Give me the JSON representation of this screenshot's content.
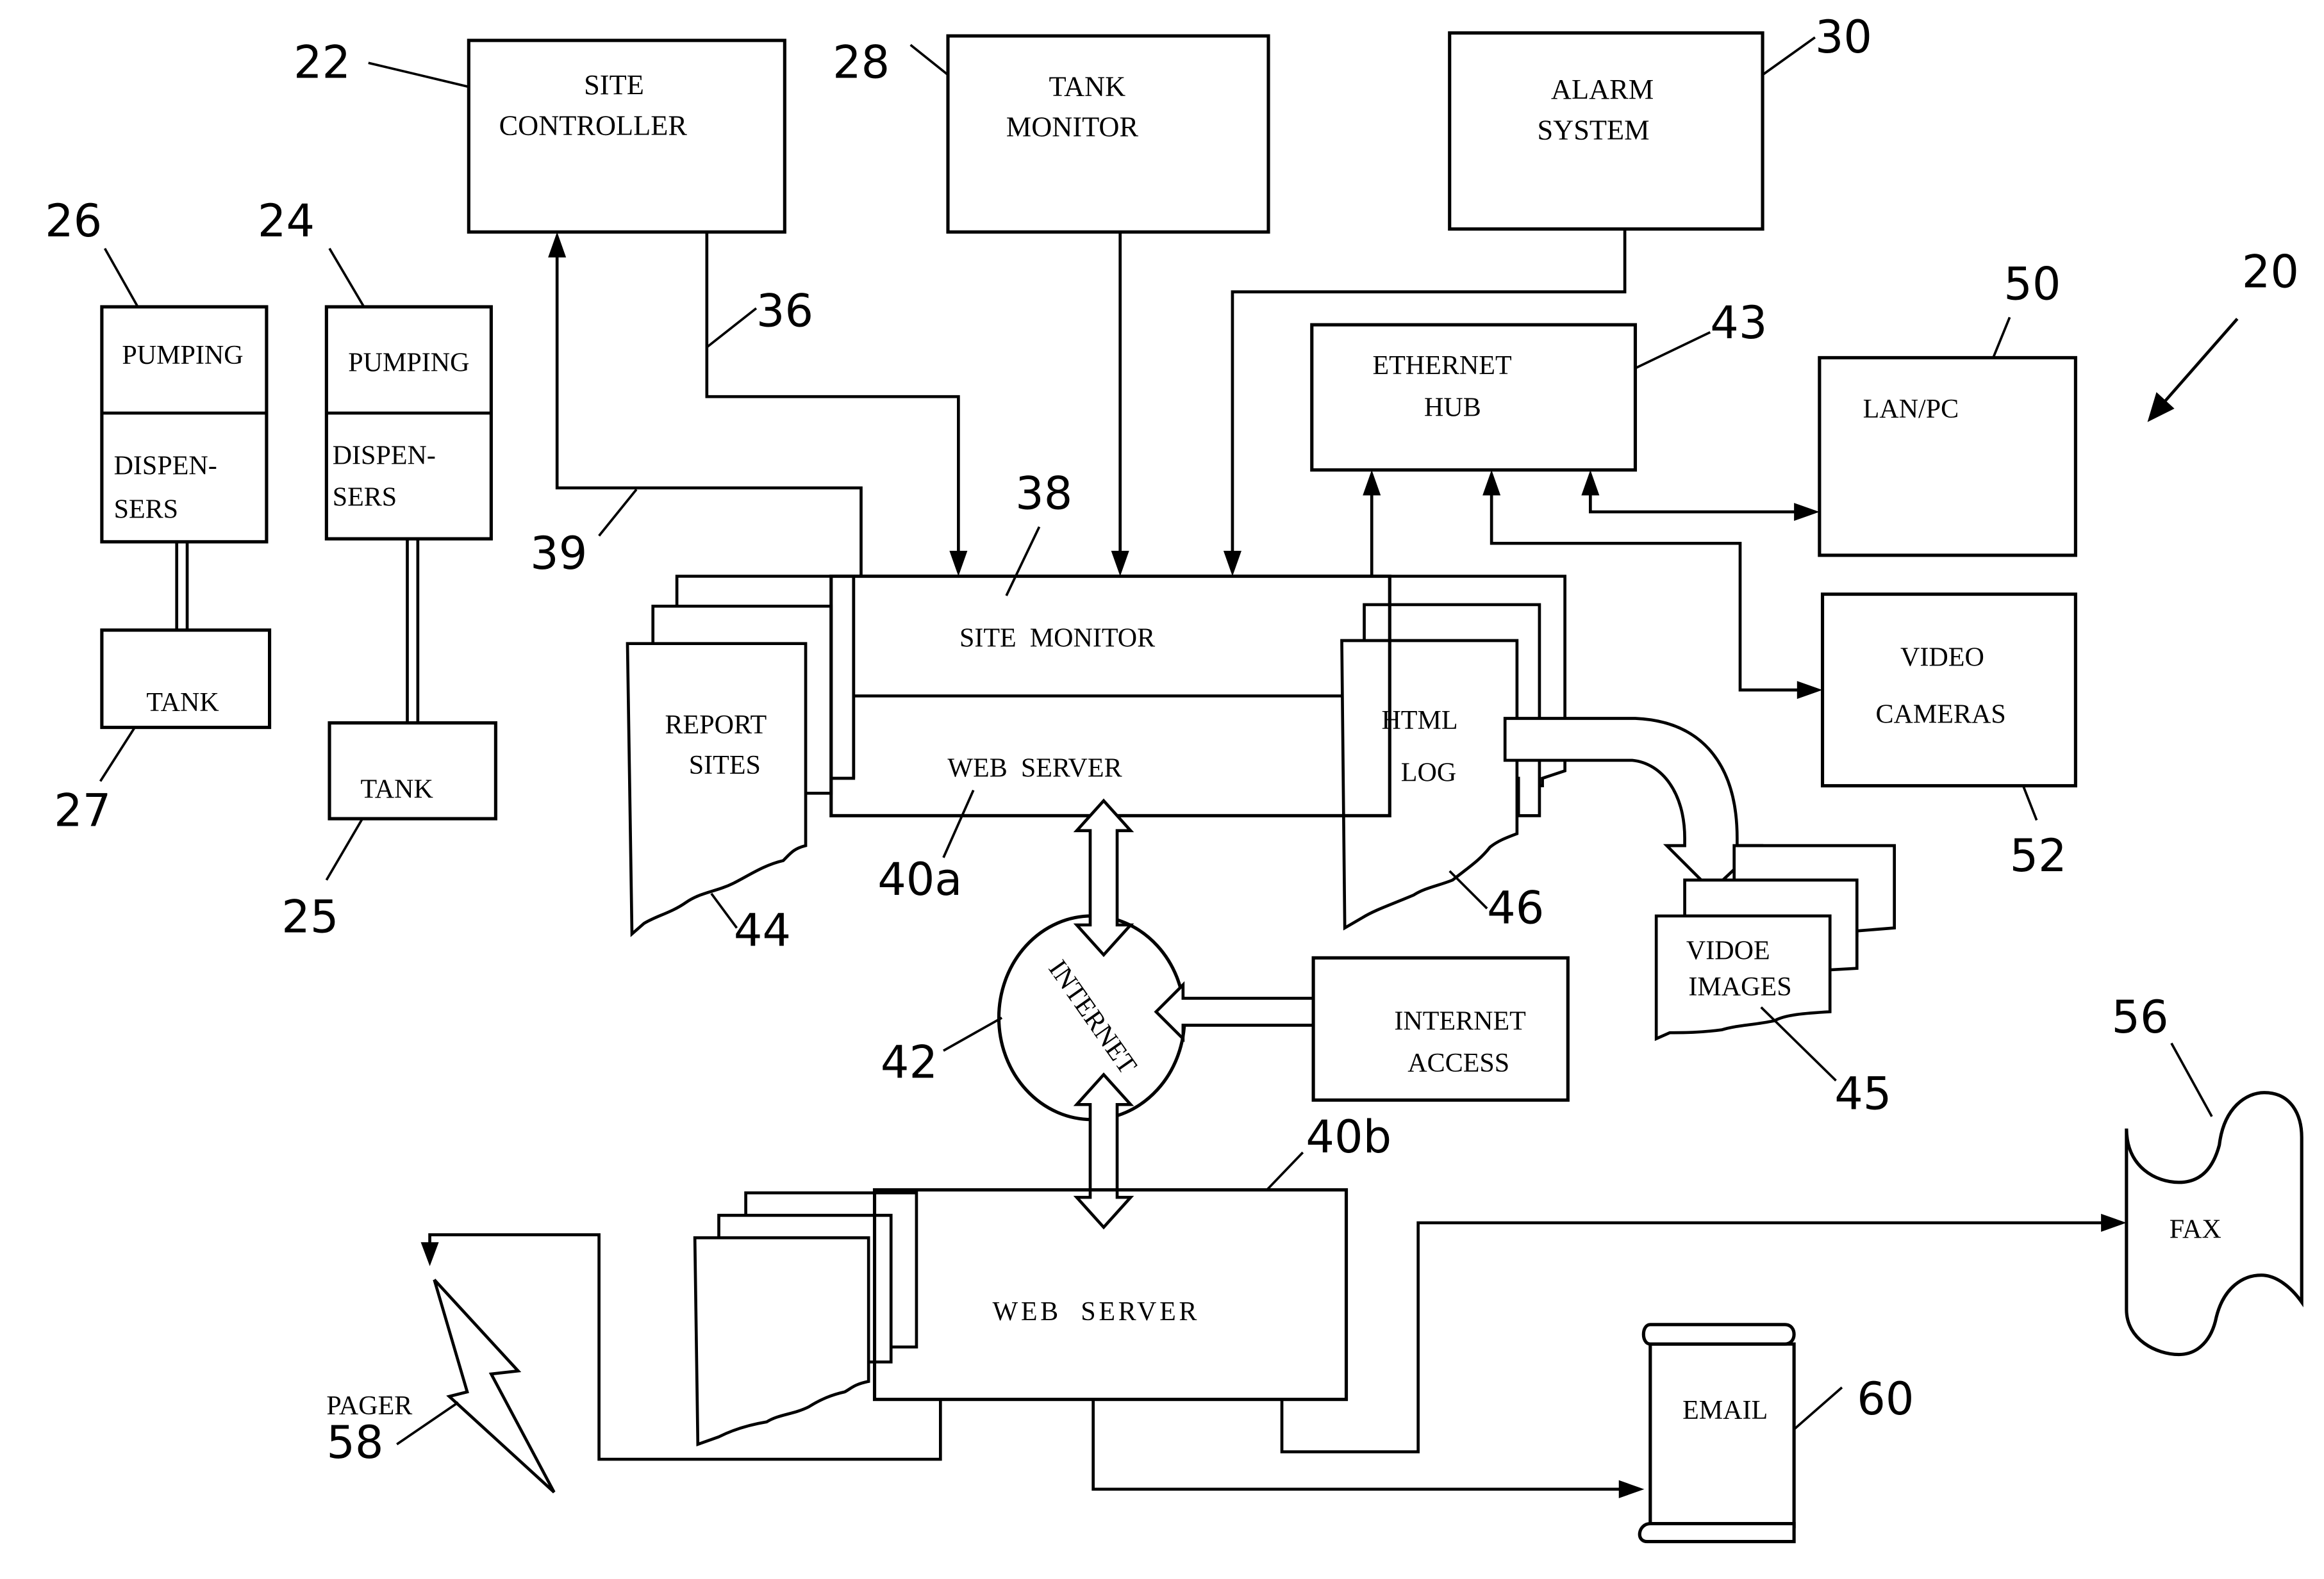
{
  "figure": {
    "reference_number": "20",
    "blocks": {
      "site_controller": {
        "ref": "22",
        "lines": [
          "SITE",
          "CONTROLLER"
        ]
      },
      "tank_monitor": {
        "ref": "28",
        "lines": [
          "TANK",
          "MONITOR"
        ]
      },
      "alarm_system": {
        "ref": "30",
        "lines": [
          "ALARM",
          "SYSTEM"
        ]
      },
      "pumping_26": {
        "ref": "26",
        "top": "PUMPING",
        "bottom": [
          "DISPEN-",
          "SERS"
        ]
      },
      "pumping_24": {
        "ref": "24",
        "top": "PUMPING",
        "bottom": [
          "DISPEN-",
          "SERS"
        ]
      },
      "tank_27": {
        "ref": "27",
        "label": "TANK"
      },
      "tank_25": {
        "ref": "25",
        "label": "TANK"
      },
      "ethernet_hub": {
        "ref": "43",
        "lines": [
          "ETHERNET",
          "HUB"
        ]
      },
      "lan_pc": {
        "ref": "50",
        "label": "LAN/PC"
      },
      "video_cameras": {
        "ref": "52",
        "lines": [
          "VIDEO",
          "CAMERAS"
        ]
      },
      "site_monitor": {
        "ref": "38",
        "label": "SITE  MONITOR"
      },
      "web_server_a": {
        "ref": "40a",
        "label": "WEB  SERVER"
      },
      "report_sites": {
        "ref": "44",
        "lines": [
          "REPORT",
          "SITES"
        ]
      },
      "html_log": {
        "ref": "46",
        "lines": [
          "HTML",
          "LOG"
        ]
      },
      "video_images": {
        "ref": "45",
        "lines": [
          "VIDOE",
          "IMAGES"
        ]
      },
      "internet": {
        "ref": "42",
        "label": "INTERNET"
      },
      "internet_access": {
        "lines": [
          "INTERNET",
          "ACCESS"
        ]
      },
      "web_server_b": {
        "ref": "40b",
        "label": "WEB  SERVER"
      },
      "fax": {
        "ref": "56",
        "label": "FAX"
      },
      "email": {
        "ref": "60",
        "label": "EMAIL"
      },
      "pager": {
        "ref": "58",
        "label": "PAGER"
      }
    },
    "connection_refs": {
      "controller_to_monitor": "36",
      "monitor_to_controller": "39"
    }
  }
}
